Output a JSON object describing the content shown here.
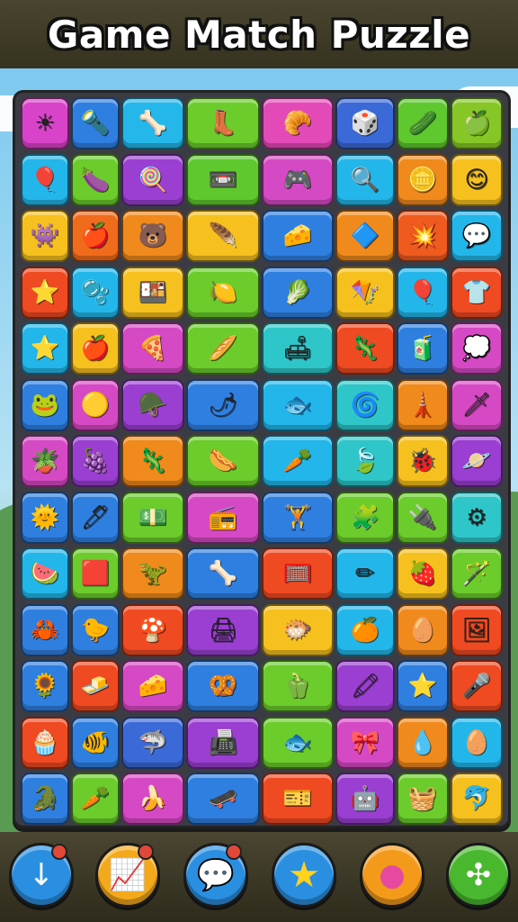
{
  "title": "Game Match Puzzle",
  "board": {
    "rows": [
      [
        {
          "c": "#d943c9",
          "i": "☀"
        },
        {
          "c": "#2f7fe0",
          "i": "🔦"
        },
        {
          "c": "#25b7ea",
          "i": "🦴"
        },
        {
          "c": "#6bcc2c",
          "i": "👢"
        },
        {
          "c": "#e34ab8",
          "i": "🥐"
        },
        {
          "c": "#3b69d8",
          "i": "🎲"
        },
        {
          "c": "#5fc82e",
          "i": "🥒"
        },
        {
          "c": "#86c727",
          "i": "🍏"
        }
      ],
      [
        {
          "c": "#23b6ea",
          "i": "🎈"
        },
        {
          "c": "#6bcc2c",
          "i": "🍆"
        },
        {
          "c": "#9a3fd1",
          "i": "🍭"
        },
        {
          "c": "#5fc82e",
          "i": "📼"
        },
        {
          "c": "#d649c4",
          "i": "🎮"
        },
        {
          "c": "#23b6ea",
          "i": "🔍"
        },
        {
          "c": "#f08a1c",
          "i": "🪙"
        },
        {
          "c": "#f6c11e",
          "i": "😊"
        }
      ],
      [
        {
          "c": "#f6c11e",
          "i": "👾"
        },
        {
          "c": "#f06b1c",
          "i": "🍎"
        },
        {
          "c": "#f08a1c",
          "i": "🐻"
        },
        {
          "c": "#f6c11e",
          "i": "🪶"
        },
        {
          "c": "#2f7fe0",
          "i": "🧀"
        },
        {
          "c": "#f08a1c",
          "i": "🔷"
        },
        {
          "c": "#ef5a1e",
          "i": "💥"
        },
        {
          "c": "#23b6ea",
          "i": "💬"
        }
      ],
      [
        {
          "c": "#ef4a22",
          "i": "⭐"
        },
        {
          "c": "#23b6ea",
          "i": "🫧"
        },
        {
          "c": "#f6c11e",
          "i": "🍱"
        },
        {
          "c": "#6bcc2c",
          "i": "🍋"
        },
        {
          "c": "#2f7fe0",
          "i": "🥬"
        },
        {
          "c": "#f6c11e",
          "i": "🪁"
        },
        {
          "c": "#23b6ea",
          "i": "🎈"
        },
        {
          "c": "#ef4a22",
          "i": "👕"
        }
      ],
      [
        {
          "c": "#23b6ea",
          "i": "⭐"
        },
        {
          "c": "#f6c11e",
          "i": "🍎"
        },
        {
          "c": "#d649c4",
          "i": "🍕"
        },
        {
          "c": "#6bcc2c",
          "i": "🥖"
        },
        {
          "c": "#2ec6c8",
          "i": "🛋"
        },
        {
          "c": "#ef4a22",
          "i": "🦎"
        },
        {
          "c": "#2f7fe0",
          "i": "🧃"
        },
        {
          "c": "#d649c4",
          "i": "💭"
        }
      ],
      [
        {
          "c": "#2f7fe0",
          "i": "🐸"
        },
        {
          "c": "#d649c4",
          "i": "🟡"
        },
        {
          "c": "#9a3fd1",
          "i": "🪖"
        },
        {
          "c": "#2f7fe0",
          "i": "🌶"
        },
        {
          "c": "#23b6ea",
          "i": "🐟"
        },
        {
          "c": "#2ec6c8",
          "i": "🌀"
        },
        {
          "c": "#f08a1c",
          "i": "🗼"
        },
        {
          "c": "#d649c4",
          "i": "🗡"
        }
      ],
      [
        {
          "c": "#d649c4",
          "i": "🪴"
        },
        {
          "c": "#9a3fd1",
          "i": "🍇"
        },
        {
          "c": "#f08a1c",
          "i": "🦎"
        },
        {
          "c": "#6bcc2c",
          "i": "🌭"
        },
        {
          "c": "#23b6ea",
          "i": "🥕"
        },
        {
          "c": "#2ec6c8",
          "i": "🍃"
        },
        {
          "c": "#f6c11e",
          "i": "🐞"
        },
        {
          "c": "#9a3fd1",
          "i": "🪐"
        }
      ],
      [
        {
          "c": "#2f7fe0",
          "i": "🌞"
        },
        {
          "c": "#2f7fe0",
          "i": "🖊"
        },
        {
          "c": "#6bcc2c",
          "i": "💵"
        },
        {
          "c": "#d649c4",
          "i": "📻"
        },
        {
          "c": "#2f7fe0",
          "i": "🏋"
        },
        {
          "c": "#6bcc2c",
          "i": "🧩"
        },
        {
          "c": "#6bcc2c",
          "i": "🔌"
        },
        {
          "c": "#2ec6c8",
          "i": "⚙"
        }
      ],
      [
        {
          "c": "#23b6ea",
          "i": "🍉"
        },
        {
          "c": "#6bcc2c",
          "i": "🟥"
        },
        {
          "c": "#f08a1c",
          "i": "🦖"
        },
        {
          "c": "#2f7fe0",
          "i": "🦴"
        },
        {
          "c": "#ef4a22",
          "i": "🥅"
        },
        {
          "c": "#23b6ea",
          "i": "✏"
        },
        {
          "c": "#f6c11e",
          "i": "🍓"
        },
        {
          "c": "#6bcc2c",
          "i": "🪄"
        }
      ],
      [
        {
          "c": "#2f7fe0",
          "i": "🦀"
        },
        {
          "c": "#2f7fe0",
          "i": "🐤"
        },
        {
          "c": "#ef4a22",
          "i": "🍄"
        },
        {
          "c": "#9a3fd1",
          "i": "🖨"
        },
        {
          "c": "#f6c11e",
          "i": "🐡"
        },
        {
          "c": "#23b6ea",
          "i": "🍊"
        },
        {
          "c": "#f08a1c",
          "i": "🥚"
        },
        {
          "c": "#ef4a22",
          "i": "🖼"
        }
      ],
      [
        {
          "c": "#2f7fe0",
          "i": "🌻"
        },
        {
          "c": "#ef4a22",
          "i": "🧈"
        },
        {
          "c": "#d649c4",
          "i": "🧀"
        },
        {
          "c": "#2f7fe0",
          "i": "🥨"
        },
        {
          "c": "#6bcc2c",
          "i": "🫑"
        },
        {
          "c": "#9a3fd1",
          "i": "🖍"
        },
        {
          "c": "#2f7fe0",
          "i": "⭐"
        },
        {
          "c": "#ef4a22",
          "i": "🎤"
        }
      ],
      [
        {
          "c": "#ef4a22",
          "i": "🧁"
        },
        {
          "c": "#2f7fe0",
          "i": "🐠"
        },
        {
          "c": "#3b69d8",
          "i": "🦈"
        },
        {
          "c": "#9a3fd1",
          "i": "📠"
        },
        {
          "c": "#6bcc2c",
          "i": "🐟"
        },
        {
          "c": "#d649c4",
          "i": "🎀"
        },
        {
          "c": "#f08a1c",
          "i": "💧"
        },
        {
          "c": "#23b6ea",
          "i": "🥚"
        }
      ],
      [
        {
          "c": "#2f7fe0",
          "i": "🐊"
        },
        {
          "c": "#6bcc2c",
          "i": "🥕"
        },
        {
          "c": "#d649c4",
          "i": "🍌"
        },
        {
          "c": "#2f7fe0",
          "i": "🛹"
        },
        {
          "c": "#ef4a22",
          "i": "🎫"
        },
        {
          "c": "#9a3fd1",
          "i": "🤖"
        },
        {
          "c": "#6bcc2c",
          "i": "🧺"
        },
        {
          "c": "#f6c11e",
          "i": "🐬"
        }
      ]
    ]
  },
  "toolbar": [
    {
      "name": "download-button",
      "icon": "arrow-down-icon",
      "glyph": "↓",
      "color": "#2a8fe0"
    },
    {
      "name": "chart-button",
      "icon": "chart-icon",
      "glyph": "📈",
      "color": "#f3a91b"
    },
    {
      "name": "chat-button",
      "icon": "chat-bubble-icon",
      "glyph": "💬",
      "color": "#2a8fe0"
    },
    {
      "name": "star-button",
      "icon": "star-icon",
      "glyph": "★",
      "color": "#2a8fe0"
    },
    {
      "name": "palette-button",
      "icon": "palette-icon",
      "glyph": "●",
      "color": "#f39a1b"
    },
    {
      "name": "shuffle-button",
      "icon": "shuffle-icon",
      "glyph": "✣",
      "color": "#49b82e"
    }
  ]
}
